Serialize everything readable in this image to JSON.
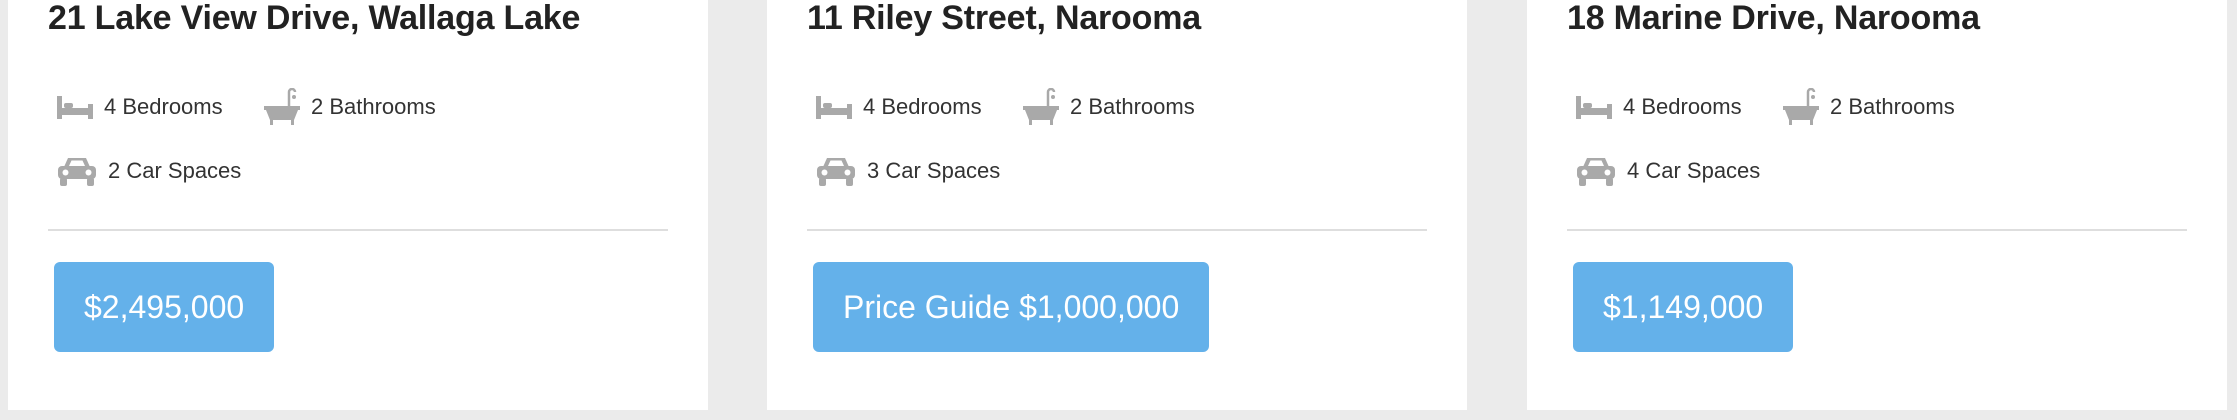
{
  "listings": [
    {
      "address": "21 Lake View Drive, Wallaga Lake",
      "bedrooms": "4 Bedrooms",
      "bathrooms": "2 Bathrooms",
      "car_spaces": "2 Car Spaces",
      "price": "$2,495,000"
    },
    {
      "address": "11 Riley Street, Narooma",
      "bedrooms": "4 Bedrooms",
      "bathrooms": "2 Bathrooms",
      "car_spaces": "3 Car Spaces",
      "price": "Price Guide $1,000,000"
    },
    {
      "address": "18 Marine Drive, Narooma",
      "bedrooms": "4 Bedrooms",
      "bathrooms": "2 Bathrooms",
      "car_spaces": "4 Car Spaces",
      "price": "$1,149,000"
    }
  ],
  "icons": {
    "bed": "bed-icon",
    "bath": "bathtub-icon",
    "car": "car-icon"
  },
  "colors": {
    "page_background": "#ebebeb",
    "card_background": "#ffffff",
    "price_button": "#64b1ea",
    "icon_gray": "#a9a9a9",
    "title_text": "#222222",
    "feature_text": "#333333"
  }
}
